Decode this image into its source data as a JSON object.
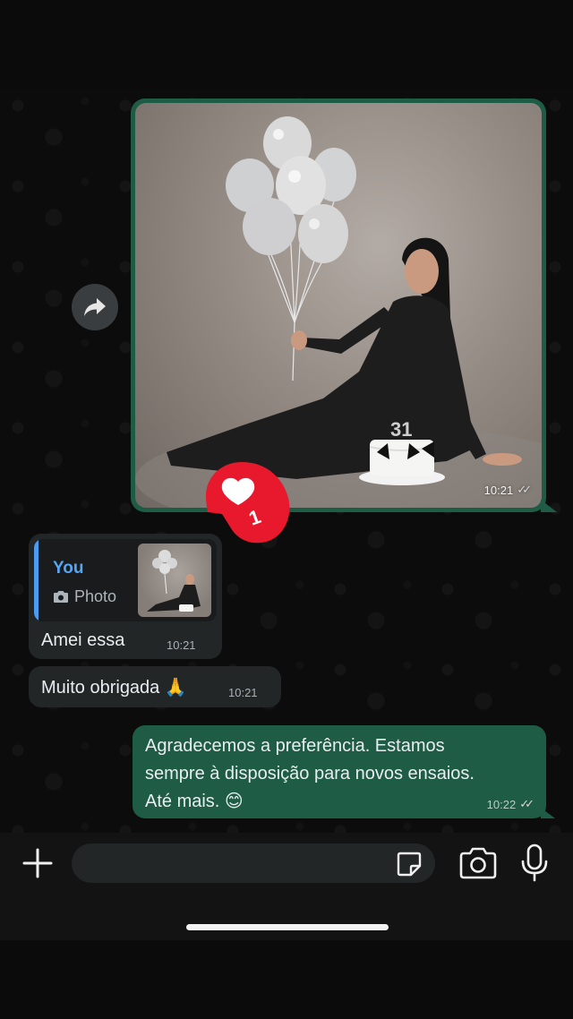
{
  "messages": {
    "photo": {
      "time": "10:21",
      "reaction_count": "1",
      "cake_number": "31"
    },
    "reply": {
      "quote_author": "You",
      "quote_type": "Photo",
      "text": "Amei essa",
      "time": "10:21"
    },
    "thanks": {
      "text": "Muito obrigada 🙏",
      "time": "10:21"
    },
    "outgoing": {
      "line1": "Agradecemos a preferência. Estamos",
      "line2": "sempre à disposição para novos ensaios.",
      "line3": "Até mais. 😊",
      "time": "10:22"
    }
  },
  "icons": {
    "forward": "forward-arrow-icon",
    "reaction": "heart-icon",
    "attach": "plus-icon",
    "sticker": "sticker-icon",
    "camera": "camera-icon",
    "mic": "microphone-icon",
    "read": "double-check-icon"
  },
  "colors": {
    "outgoing_bubble": "#1f5c45",
    "incoming_bubble": "#232627",
    "reaction_badge": "#e8192c",
    "quote_accent": "#53a7f5"
  }
}
